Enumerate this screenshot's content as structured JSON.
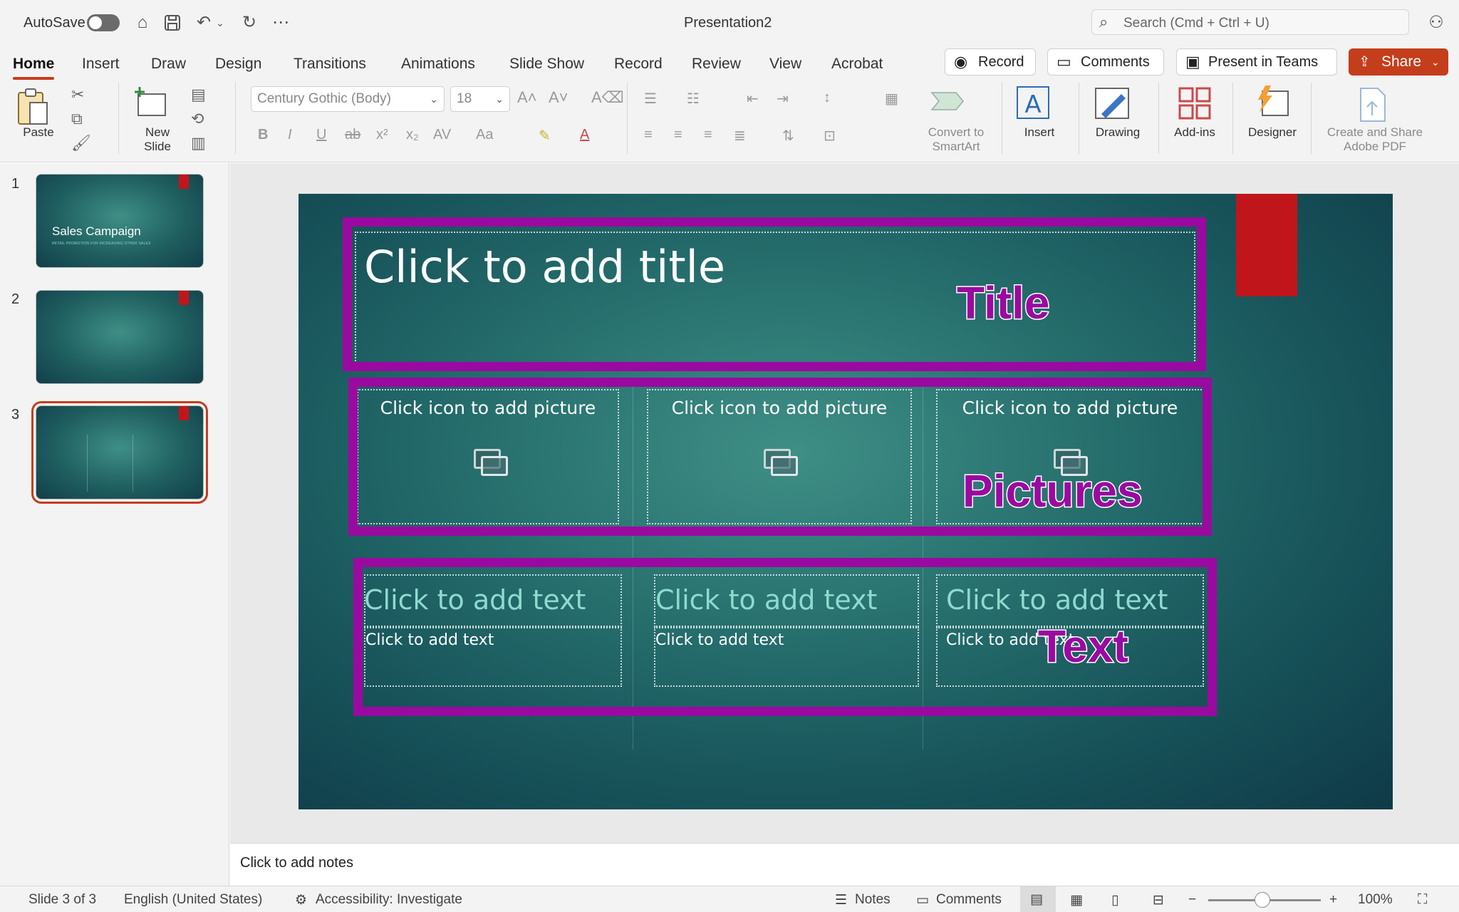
{
  "app": {
    "title": "Presentation2",
    "autosave_label": "AutoSave",
    "search_placeholder": "Search (Cmd + Ctrl + U)"
  },
  "tabs": [
    "Home",
    "Insert",
    "Draw",
    "Design",
    "Transitions",
    "Animations",
    "Slide Show",
    "Record",
    "Review",
    "View",
    "Acrobat"
  ],
  "tab_buttons": {
    "record": "Record",
    "comments": "Comments",
    "present": "Present in Teams",
    "share": "Share"
  },
  "ribbon": {
    "paste": "Paste",
    "new_slide": "New Slide",
    "font_name": "Century Gothic (Body)",
    "font_size": "18",
    "convert_smartart": "Convert to SmartArt",
    "insert": "Insert",
    "drawing": "Drawing",
    "addins": "Add-ins",
    "designer": "Designer",
    "adobe": "Create and Share Adobe PDF"
  },
  "thumbnails": [
    {
      "number": "1",
      "title": "Sales Campaign",
      "subtitle": "RETAIL PROMOTION FOR INCREASING OTHER SALES"
    },
    {
      "number": "2"
    },
    {
      "number": "3",
      "selected": true
    }
  ],
  "slide": {
    "title_placeholder": "Click to add title",
    "picture_placeholders": [
      "Click icon to add picture",
      "Click icon to add picture",
      "Click icon to add picture"
    ],
    "text_heads": [
      "Click to add text",
      "Click to add text",
      "Click to add text"
    ],
    "text_bodies": [
      "Click to add text",
      "Click to add text",
      "Click to add text"
    ],
    "annotations": {
      "title": "Title",
      "pictures": "Pictures",
      "text": "Text"
    },
    "annotation_color": "#9a0aa0",
    "accent_flag_color": "#c0161b"
  },
  "notes_placeholder": "Click to add notes",
  "status": {
    "slide_info": "Slide 3 of 3",
    "language": "English (United States)",
    "accessibility": "Accessibility: Investigate",
    "notes": "Notes",
    "comments": "Comments",
    "zoom": "100%"
  },
  "colors": {
    "accent": "#c43e1c",
    "slide_bg": "#1f5f60"
  }
}
